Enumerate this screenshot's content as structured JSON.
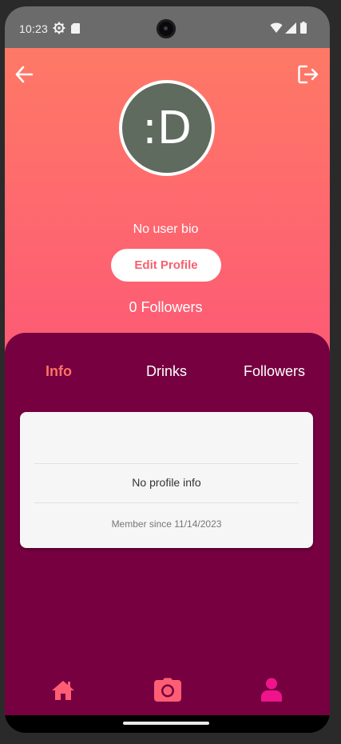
{
  "status_bar": {
    "time": "10:23",
    "icons": [
      "gear-icon",
      "sd-card-icon",
      "wifi-icon",
      "signal-icon",
      "battery-icon"
    ]
  },
  "header": {
    "back_icon": "arrow-left-icon",
    "logout_icon": "logout-icon"
  },
  "profile": {
    "avatar_text": ":D",
    "bio": "No user bio",
    "edit_button_label": "Edit Profile",
    "followers_text": "0 Followers"
  },
  "tabs": [
    {
      "label": "Info",
      "active": true
    },
    {
      "label": "Drinks",
      "active": false
    },
    {
      "label": "Followers",
      "active": false
    }
  ],
  "info_card": {
    "empty_text": "No profile info",
    "member_since": "Member since 11/14/2023"
  },
  "bottom_nav": {
    "items": [
      {
        "icon": "home-icon",
        "color": "#fd5e73"
      },
      {
        "icon": "camera-icon",
        "color": "#fd5e73"
      },
      {
        "icon": "user-icon",
        "color": "#f0148c"
      }
    ]
  },
  "colors": {
    "gradient_top": "#fe7966",
    "gradient_bottom": "#fb4a7d",
    "panel": "#760040",
    "active_tab": "#fd7264",
    "active_nav": "#f0148c"
  }
}
